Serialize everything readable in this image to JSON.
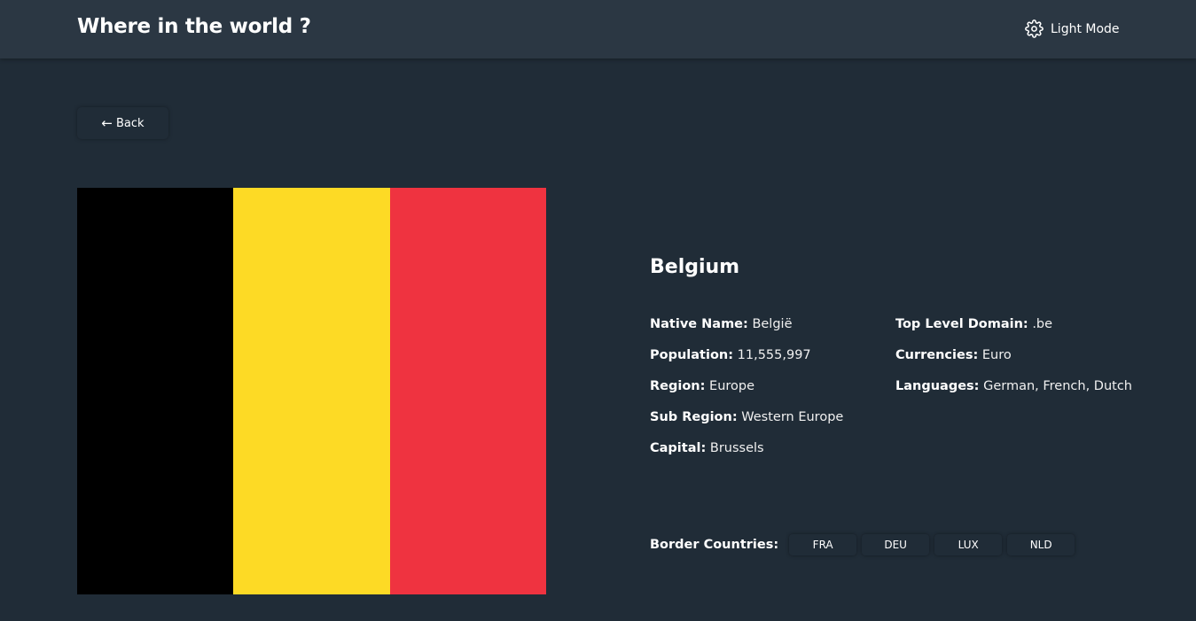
{
  "header": {
    "title": "Where in the world ?",
    "mode_label": "Light Mode",
    "mode_icon": "gear-icon"
  },
  "back_button": {
    "label": "Back",
    "icon": "arrow-left-icon"
  },
  "flag": {
    "colors": [
      "#000000",
      "#fdda25",
      "#ef3340"
    ]
  },
  "country": {
    "name": "Belgium",
    "left_details": [
      {
        "label": "Native Name:",
        "value": "België"
      },
      {
        "label": "Population:",
        "value": "11,555,997"
      },
      {
        "label": "Region:",
        "value": "Europe"
      },
      {
        "label": "Sub Region:",
        "value": "Western Europe"
      },
      {
        "label": "Capital:",
        "value": "Brussels"
      }
    ],
    "right_details": [
      {
        "label": "Top Level Domain:",
        "value": ".be"
      },
      {
        "label": "Currencies:",
        "value": "Euro"
      },
      {
        "label": "Languages:",
        "value": "German, French, Dutch"
      }
    ],
    "border_label": "Border Countries:",
    "borders": [
      "FRA",
      "DEU",
      "LUX",
      "NLD"
    ]
  },
  "colors": {
    "background": "#202c37",
    "elements": "#2b3743",
    "text": "#ffffff"
  }
}
